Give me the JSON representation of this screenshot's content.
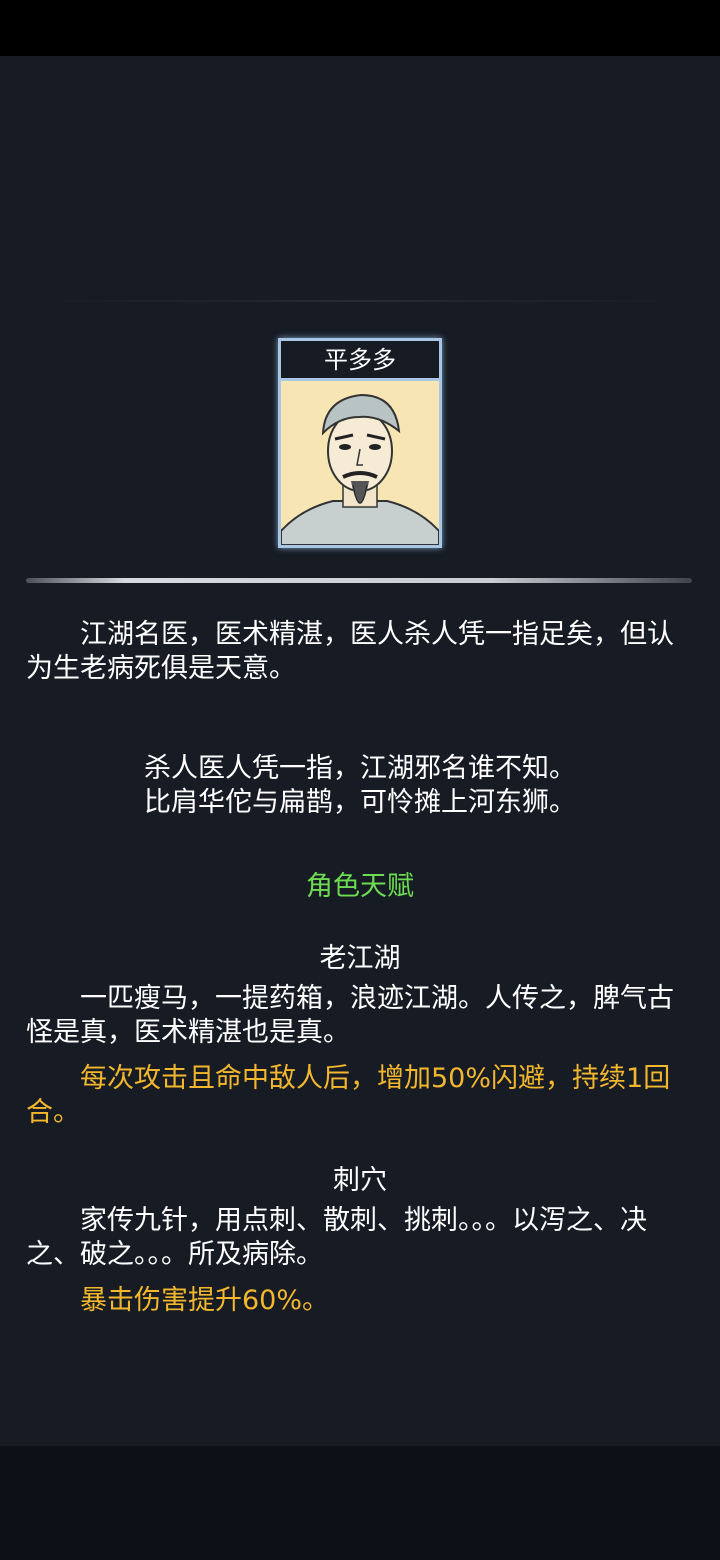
{
  "character": {
    "name": "平多多",
    "description": "江湖名医，医术精湛，医人杀人凭一指足矣，但认为生老病死俱是天意。",
    "poem_line1": "杀人医人凭一指，江湖邪名谁不知。",
    "poem_line2": "比肩华佗与扁鹊，可怜摊上河东狮。"
  },
  "talents": {
    "heading": "角色天赋",
    "items": [
      {
        "name": "老江湖",
        "description": "一匹瘦马，一提药箱，浪迹江湖。人传之，脾气古怪是真，医术精湛也是真。",
        "effect": "每次攻击且命中敌人后，增加50%闪避，持续1回合。"
      },
      {
        "name": "刺穴",
        "description": "家传九针，用点刺、散刺、挑刺。。。以泻之、决之、破之。。。所及病除。",
        "effect": "暴击伤害提升60%。"
      }
    ]
  },
  "colors": {
    "background": "#161b24",
    "effect_text": "#f3b72d",
    "heading": "#6ddc52",
    "card_frame": "#a7c7e4"
  }
}
